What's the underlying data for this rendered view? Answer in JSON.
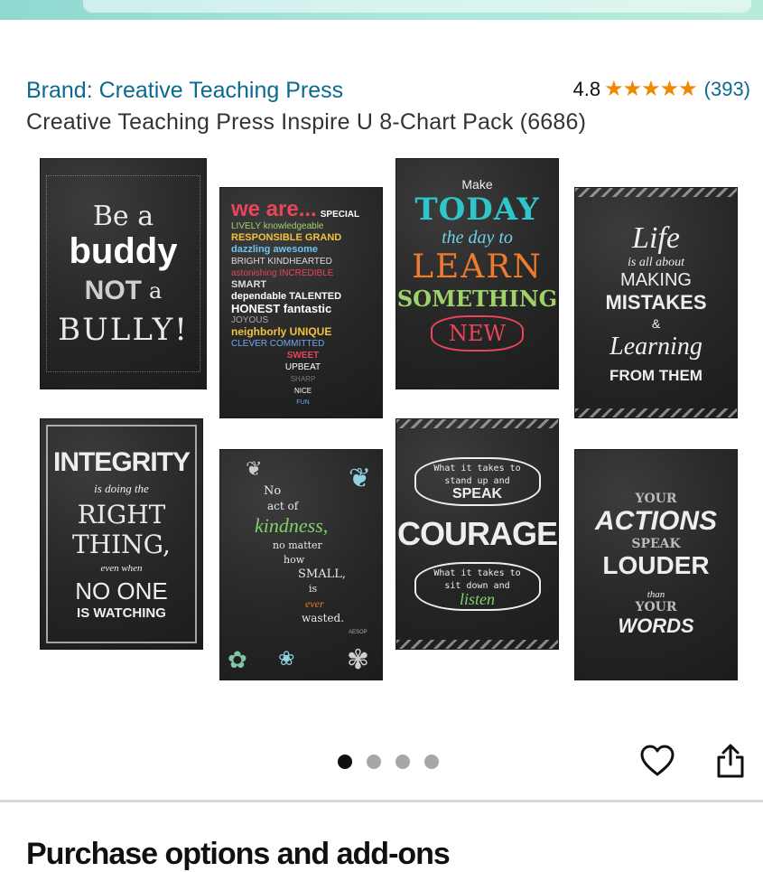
{
  "brand_link": "Brand: Creative Teaching Press",
  "rating": {
    "score": "4.8",
    "stars_value": 4.8,
    "count": "(393)"
  },
  "product_title": "Creative Teaching Press Inspire U 8-Chart Pack (6686)",
  "carousel": {
    "total": 4,
    "active_index": 0
  },
  "posters": {
    "p1": {
      "l1": "Be a",
      "l2": "buddy",
      "l3": "NOT",
      "l3b": "a",
      "l4": "BULLY!"
    },
    "p2": {
      "head1": "we are...",
      "head2": "SPECIAL",
      "words": [
        "LIVELY knowledgeable",
        "RESPONSIBLE GRAND",
        "dazzling awesome",
        "BRIGHT KINDHEARTED",
        "astonishing INCREDIBLE",
        "SMART",
        "dependable TALENTED",
        "HONEST fantastic",
        "JOYOUS",
        "neighborly UNIQUE",
        "CLEVER COMMITTED",
        "SWEET",
        "UPBEAT",
        "SHARP",
        "NICE",
        "FUN"
      ]
    },
    "p3": {
      "l1": "Make",
      "l2": "TODAY",
      "l3": "the day to",
      "l4": "LEARN",
      "l5": "SOMETHING",
      "l6": "NEW"
    },
    "p4": {
      "l1": "Life",
      "l2": "is all about",
      "l3": "MAKING",
      "l4": "MISTAKES",
      "l5": "&",
      "l6": "Learning",
      "l7": "FROM THEM"
    },
    "p5": {
      "l1": "INTEGRITY",
      "l2": "is doing the",
      "l3": "RIGHT",
      "l4": "THING,",
      "l5": "even when",
      "l6": "NO ONE",
      "l7": "IS WATCHING"
    },
    "p6": {
      "l1": "No",
      "l2": "act of",
      "l3": "kindness,",
      "l4": "no matter",
      "l5": "how",
      "l6": "SMALL,",
      "l7": "is",
      "l8": "ever",
      "l9": "wasted.",
      "l10": "AESOP"
    },
    "p7": {
      "l1": "What it takes to stand up and",
      "l2": "SPEAK",
      "l3": "COURAGE",
      "l4": "What it takes to sit down and",
      "l5": "listen"
    },
    "p8": {
      "l1": "YOUR",
      "l2": "ACTIONS",
      "l3": "SPEAK",
      "l4": "LOUDER",
      "l5": "than",
      "l6": "YOUR",
      "l7": "WORDS"
    }
  },
  "icons": {
    "heart": "heart-icon",
    "share": "share-icon"
  },
  "section_title": "Purchase options and add-ons",
  "colors": {
    "link": "#0a6b8f",
    "star": "#f08804",
    "text": "#0f1111"
  }
}
